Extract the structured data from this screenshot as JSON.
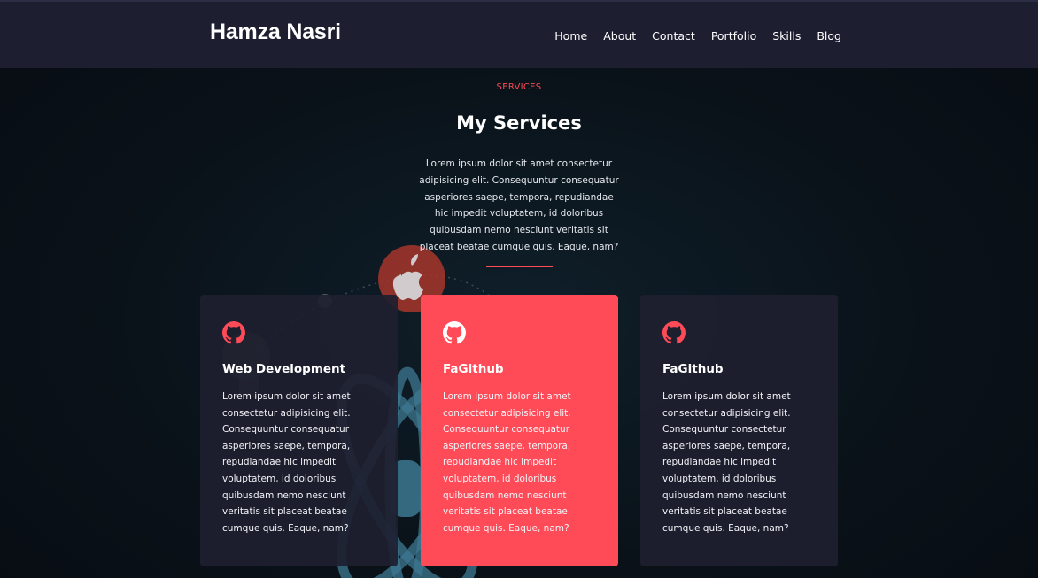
{
  "navbar": {
    "brand": "Hamza Nasri",
    "links": [
      "Home",
      "About",
      "Contact",
      "Portfolio",
      "Skills",
      "Blog"
    ]
  },
  "section": {
    "eyebrow": "SERVICES",
    "title": "My Services",
    "intro": "Lorem ipsum dolor sit amet consectetur adipisicing elit. Consequuntur consequatur asperiores saepe, tempora, repudiandae hic impedit voluptatem, id doloribus quibusdam nemo nesciunt veritatis sit placeat beatae cumque quis. Eaque, nam?"
  },
  "cards": [
    {
      "icon": "github-icon",
      "title": "Web Development",
      "text": "Lorem ipsum dolor sit amet consectetur adipisicing elit. Consequuntur consequatur asperiores saepe, tempora, repudiandae hic impedit voluptatem, id doloribus quibusdam nemo nesciunt veritatis sit placeat beatae cumque quis. Eaque, nam?",
      "active": false
    },
    {
      "icon": "github-icon",
      "title": "FaGithub",
      "text": "Lorem ipsum dolor sit amet consectetur adipisicing elit. Consequuntur consequatur asperiores saepe, tempora, repudiandae hic impedit voluptatem, id doloribus quibusdam nemo nesciunt veritatis sit placeat beatae cumque quis. Eaque, nam?",
      "active": true
    },
    {
      "icon": "github-icon",
      "title": "FaGithub",
      "text": "Lorem ipsum dolor sit amet consectetur adipisicing elit. Consequuntur consectetur asperiores saepe, tempora, repudiandae hic impedit voluptatem, id doloribus quibusdam nemo nesciunt veritatis sit placeat beatae cumque quis. Eaque, nam?",
      "active": false
    }
  ],
  "colors": {
    "accent": "#ff4a57",
    "navbar": "#1d1f31",
    "card": "#1e2030",
    "background": "#0b141d"
  }
}
